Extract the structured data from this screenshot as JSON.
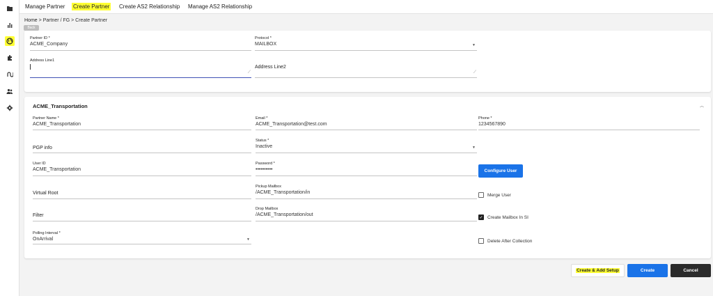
{
  "sidebar": {
    "items": [
      {
        "icon": "folder-icon"
      },
      {
        "icon": "bar-chart-icon"
      },
      {
        "icon": "globe-icon",
        "active": true
      },
      {
        "icon": "puzzle-icon"
      },
      {
        "icon": "route-icon"
      },
      {
        "icon": "people-icon"
      },
      {
        "icon": "gear-icon"
      }
    ]
  },
  "topnav": {
    "tabs": [
      "Manage Partner",
      "Create Partner",
      "Create AS2 Relationship",
      "Manage AS2 Relationship"
    ],
    "active_tab": "Create Partner"
  },
  "breadcrumb": {
    "home": "Home",
    "separator": ">",
    "rest": "Partner / FG > Create Partner",
    "back_hint": "Back"
  },
  "top_form": {
    "partner_id_label": "Partner ID *",
    "partner_id_value": "ACME_Company",
    "protocol_label": "Protocol *",
    "protocol_value": "MAILBOX",
    "address1_label": "Address Line1",
    "address1_value": "",
    "address2_placeholder": "Address Line2"
  },
  "partner_section": {
    "title": "ACME_Transportation",
    "partner_name_label": "Partner Name *",
    "partner_name_value": "ACME_Transportation",
    "email_label": "Email *",
    "email_value": "ACME_Transportation@test.com",
    "phone_label": "Phone *",
    "phone_value": "1234567890",
    "pgp_placeholder": "PGP info",
    "status_label": "Status *",
    "status_value": "Inactive",
    "user_id_label": "User ID",
    "user_id_value": "ACME_Transportation",
    "password_label": "Password *",
    "password_value": "••••••••••",
    "configure_user_label": "Configure User",
    "virtual_root_placeholder": "Virtual Root",
    "pickup_label": "Pickup Mailbox",
    "pickup_value": "/ACME_Transportation/in",
    "merge_user_label": "Merge User",
    "filter_placeholder": "Filter",
    "drop_label": "Drop Mailbox",
    "drop_value": "/ACME_Transportation/out",
    "create_mailbox_label": "Create Mailbox In SI",
    "polling_label": "Polling Interval *",
    "polling_value": "OnArrival",
    "delete_after_label": "Delete After Collection"
  },
  "checkboxes": {
    "merge_user": false,
    "create_mailbox": true,
    "delete_after": false
  },
  "actions": {
    "create_add_setup": "Create & Add Setup",
    "create": "Create",
    "cancel": "Cancel"
  },
  "colors": {
    "primary": "#1a73e8",
    "highlight": "#ffff33",
    "cancel": "#2b2b2b",
    "focus_underline": "#3f51b5"
  }
}
